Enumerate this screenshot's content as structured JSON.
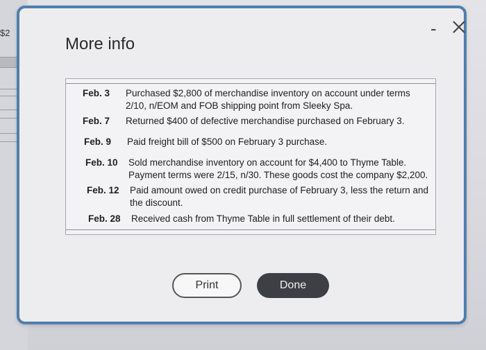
{
  "background": {
    "amount_fragment": "$2"
  },
  "dialog": {
    "title": "More info",
    "minimize_label": "-",
    "close_label": "✕",
    "entries": [
      {
        "date": "Feb. 3",
        "lines": [
          "Purchased $2,800 of merchandise inventory on account under terms",
          "2/10, n/EOM and FOB shipping point from Sleeky Spa."
        ]
      },
      {
        "date": "Feb. 7",
        "lines": [
          "Returned $400 of defective merchandise purchased on February 3."
        ]
      },
      {
        "date": "Feb. 9",
        "lines": [
          "Paid freight bill of $500 on February 3 purchase."
        ]
      },
      {
        "date": "Feb. 10",
        "lines": [
          "Sold merchandise inventory on account for $4,400 to Thyme Table.",
          "Payment terms were 2/15, n/30. These goods cost the company $2,200."
        ]
      },
      {
        "date": "Feb. 12",
        "lines": [
          "Paid amount owed on credit purchase of February 3, less the return and",
          "the discount."
        ]
      },
      {
        "date": "Feb. 28",
        "lines": [
          "Received cash from Thyme Table in full settlement of their debt."
        ]
      }
    ],
    "print_label": "Print",
    "done_label": "Done"
  },
  "colors": {
    "dialog_border": "#4f7fad",
    "done_button": "#3d3f45"
  }
}
